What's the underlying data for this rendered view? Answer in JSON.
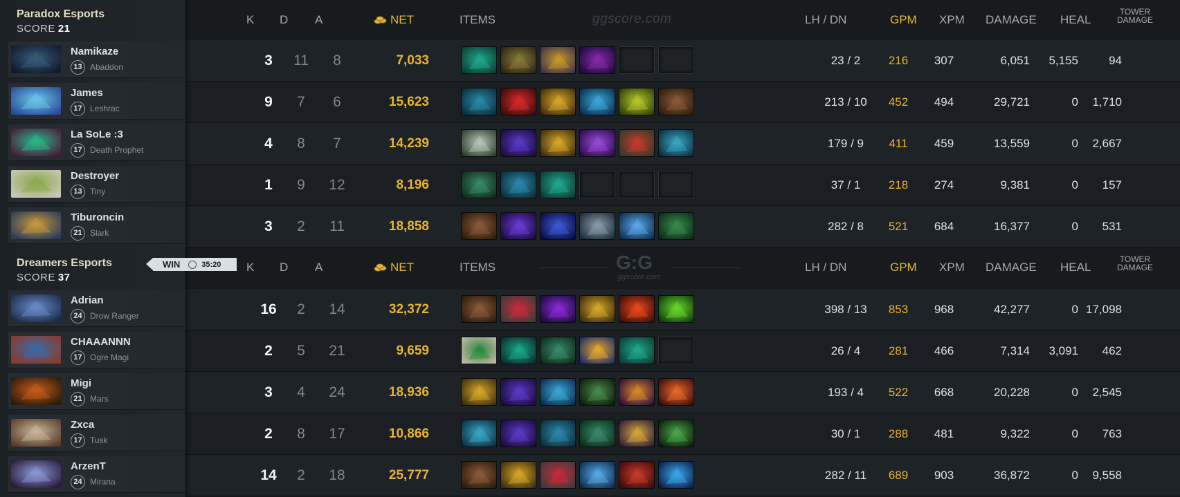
{
  "watermark_top": "ggscore.com",
  "watermark_mid_logo": "G:G",
  "watermark_mid_sub": "ggscore.com",
  "headers": {
    "k": "K",
    "d": "D",
    "a": "A",
    "net": "NET",
    "items": "ITEMS",
    "lh_dn": "LH  /  DN",
    "gpm": "GPM",
    "xpm": "XPM",
    "damage": "DAMAGE",
    "heal": "HEAL",
    "tower_line1": "TOWER",
    "tower_line2": "DAMAGE"
  },
  "win_badge": {
    "label": "WIN",
    "time": "35:20"
  },
  "teams": [
    {
      "name": "Paradox Esports",
      "score_label": "SCORE",
      "score": "21",
      "players": [
        {
          "name": "Namikaze",
          "level": "13",
          "hero": "Abaddon",
          "k": "3",
          "d": "11",
          "a": "8",
          "net": "7,033",
          "lhdn": "23  /  2",
          "gpm": "216",
          "xpm": "307",
          "damage": "6,051",
          "heal": "5,155",
          "tower": "94",
          "portrait": [
            "#3a5a7a",
            "#0e1a2c"
          ],
          "items": [
            [
              "#1fa88e",
              "#0b3a32"
            ],
            [
              "#8a7a3a",
              "#2a2410"
            ],
            [
              "#c89a2a",
              "#3a3048"
            ],
            [
              "#8a2aa8",
              "#1a0a3a"
            ],
            null,
            null
          ]
        },
        {
          "name": "James",
          "level": "17",
          "hero": "Leshrac",
          "k": "9",
          "d": "7",
          "a": "6",
          "net": "15,623",
          "lhdn": "213  /  10",
          "gpm": "452",
          "xpm": "494",
          "damage": "29,721",
          "heal": "0",
          "tower": "1,710",
          "portrait": [
            "#6ac8e8",
            "#2a4a9a"
          ],
          "items": [
            [
              "#2a8aa8",
              "#0a2a3a"
            ],
            [
              "#d82a2a",
              "#3a0a0a"
            ],
            [
              "#d8a82a",
              "#3a2a0a"
            ],
            [
              "#3aa8d8",
              "#0a2a4a"
            ],
            [
              "#b8c82a",
              "#2a3a0a"
            ],
            [
              "#8a5a3a",
              "#2a1a0a"
            ]
          ]
        },
        {
          "name": "La SoLe :3",
          "level": "17",
          "hero": "Death Prophet",
          "k": "4",
          "d": "8",
          "a": "7",
          "net": "14,239",
          "lhdn": "179  /  9",
          "gpm": "411",
          "xpm": "459",
          "damage": "13,559",
          "heal": "0",
          "tower": "2,667",
          "portrait": [
            "#2ab88a",
            "#4a1a3a"
          ],
          "items": [
            [
              "#b8c8b8",
              "#2a3a2a"
            ],
            [
              "#5a3ac8",
              "#1a0a3a"
            ],
            [
              "#d8a82a",
              "#3a2a0a"
            ],
            [
              "#9a4ad8",
              "#2a0a4a"
            ],
            [
              "#c83a2a",
              "#2a3a2a"
            ],
            [
              "#3aa8c8",
              "#0a2a3a"
            ]
          ]
        },
        {
          "name": "Destroyer",
          "level": "13",
          "hero": "Tiny",
          "k": "1",
          "d": "9",
          "a": "12",
          "net": "8,196",
          "lhdn": "37  /  1",
          "gpm": "218",
          "xpm": "274",
          "damage": "9,381",
          "heal": "0",
          "tower": "157",
          "portrait": [
            "#8aa84a",
            "#c8c8b8"
          ],
          "items": [
            [
              "#3a8a6a",
              "#0a2a1a"
            ],
            [
              "#2a8aa8",
              "#0a2a3a"
            ],
            [
              "#1fa88e",
              "#0b3a32"
            ],
            null,
            null,
            null
          ]
        },
        {
          "name": "Tiburoncin",
          "level": "21",
          "hero": "Slark",
          "k": "3",
          "d": "2",
          "a": "11",
          "net": "18,858",
          "lhdn": "282  /  8",
          "gpm": "521",
          "xpm": "684",
          "damage": "16,377",
          "heal": "0",
          "tower": "531",
          "portrait": [
            "#c8983a",
            "#2a3a5a"
          ],
          "items": [
            [
              "#8a5a3a",
              "#2a1a0a"
            ],
            [
              "#6a3ad8",
              "#1a0a3a"
            ],
            [
              "#3a5ad8",
              "#0a0a3a"
            ],
            [
              "#8a9aa8",
              "#1a2a3a"
            ],
            [
              "#5aa8e8",
              "#0a2a4a"
            ],
            [
              "#3a8a4a",
              "#0a2a1a"
            ]
          ]
        }
      ]
    },
    {
      "name": "Dreamers Esports",
      "score_label": "SCORE",
      "score": "37",
      "players": [
        {
          "name": "Adrian",
          "level": "24",
          "hero": "Drow Ranger",
          "k": "16",
          "d": "2",
          "a": "14",
          "net": "32,372",
          "lhdn": "398  /  13",
          "gpm": "853",
          "xpm": "968",
          "damage": "42,277",
          "heal": "0",
          "tower": "17,098",
          "portrait": [
            "#6a8ac8",
            "#1a2a4a"
          ],
          "items": [
            [
              "#8a5a3a",
              "#2a1a0a"
            ],
            [
              "#c82a3a",
              "#3a3a3a"
            ],
            [
              "#8a2ad8",
              "#1a0a3a"
            ],
            [
              "#d8a82a",
              "#3a2a0a"
            ],
            [
              "#e84a1a",
              "#3a0a0a"
            ],
            [
              "#6ad82a",
              "#0a3a0a"
            ]
          ]
        },
        {
          "name": "CHAAANNN",
          "level": "17",
          "hero": "Ogre Magi",
          "k": "2",
          "d": "5",
          "a": "21",
          "net": "9,659",
          "lhdn": "26  /  4",
          "gpm": "281",
          "xpm": "466",
          "damage": "7,314",
          "heal": "3,091",
          "tower": "462",
          "portrait": [
            "#3a6aa8",
            "#8a3a2a"
          ],
          "items": [
            [
              "#2a8a3a",
              "#c8b8a8"
            ],
            [
              "#1aa88a",
              "#0a2a2a"
            ],
            [
              "#3a8a6a",
              "#0a2a1a"
            ],
            [
              "#e8a82a",
              "#1a2a6a"
            ],
            [
              "#1fa88e",
              "#0b3a32"
            ],
            null
          ]
        },
        {
          "name": "Migi",
          "level": "21",
          "hero": "Mars",
          "k": "3",
          "d": "4",
          "a": "24",
          "net": "18,936",
          "lhdn": "193  /  4",
          "gpm": "522",
          "xpm": "668",
          "damage": "20,228",
          "heal": "0",
          "tower": "2,545",
          "portrait": [
            "#c85a1a",
            "#2a1a0a"
          ],
          "items": [
            [
              "#d8a82a",
              "#3a2a0a"
            ],
            [
              "#5a3ac8",
              "#1a0a3a"
            ],
            [
              "#3aa8d8",
              "#0a2a4a"
            ],
            [
              "#4a8a4a",
              "#0a1a0a"
            ],
            [
              "#d88a2a",
              "#2a0a3a"
            ],
            [
              "#e86a2a",
              "#3a0a0a"
            ]
          ]
        },
        {
          "name": "Zxca",
          "level": "17",
          "hero": "Tusk",
          "k": "2",
          "d": "8",
          "a": "17",
          "net": "10,866",
          "lhdn": "30  /  1",
          "gpm": "288",
          "xpm": "481",
          "damage": "9,322",
          "heal": "0",
          "tower": "763",
          "portrait": [
            "#c8b89a",
            "#5a3a2a"
          ],
          "items": [
            [
              "#3aa8c8",
              "#0a2a3a"
            ],
            [
              "#5a3ac8",
              "#1a0a3a"
            ],
            [
              "#2a8aa8",
              "#0a2a3a"
            ],
            [
              "#3a8a6a",
              "#0a2a1a"
            ],
            [
              "#d8a83a",
              "#2a1a3a"
            ],
            [
              "#4aa84a",
              "#0a1a0a"
            ]
          ]
        },
        {
          "name": "ArzenT",
          "level": "24",
          "hero": "Mirana",
          "k": "14",
          "d": "2",
          "a": "18",
          "net": "25,777",
          "lhdn": "282  /  11",
          "gpm": "689",
          "xpm": "903",
          "damage": "36,872",
          "heal": "0",
          "tower": "9,558",
          "portrait": [
            "#8a9ad8",
            "#2a1a3a"
          ],
          "items": [
            [
              "#8a5a3a",
              "#2a1a0a"
            ],
            [
              "#d8a82a",
              "#3a2a0a"
            ],
            [
              "#c82a3a",
              "#3a3a3a"
            ],
            [
              "#5aa8e8",
              "#0a2a4a"
            ],
            [
              "#c83a2a",
              "#3a0a0a"
            ],
            [
              "#3aa8e8",
              "#0a1a4a"
            ]
          ]
        }
      ]
    }
  ]
}
